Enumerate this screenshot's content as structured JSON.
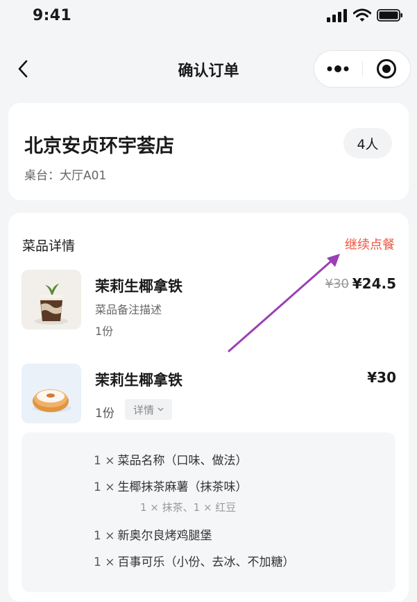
{
  "status_bar": {
    "time": "9:41"
  },
  "nav": {
    "title": "确认订单"
  },
  "store": {
    "name": "北京安贞环宇荟店",
    "table": "桌台：大厅A01",
    "people": "4人"
  },
  "order": {
    "section_title": "菜品详情",
    "continue_label": "继续点餐",
    "items": [
      {
        "name": "茉莉生椰拿铁",
        "note": "菜品备注描述",
        "qty": "1份",
        "original_price": "¥30",
        "price": "¥24.5"
      },
      {
        "name": "茉莉生椰拿铁",
        "qty": "1份",
        "price": "¥30",
        "detail_label": "详情"
      }
    ],
    "combo": [
      {
        "qty": "1 ×",
        "name": "菜品名称（口味、做法）"
      },
      {
        "qty": "1 ×",
        "name": "生椰抹茶麻薯（抹茶味）",
        "sub": "1 × 抹茶、1 × 红豆"
      },
      {
        "qty": "1 ×",
        "name": "新奥尔良烤鸡腿堡"
      },
      {
        "qty": "1 ×",
        "name": "百事可乐（小份、去冰、不加糖）"
      }
    ]
  },
  "colors": {
    "accent": "#f0553f",
    "annotation_arrow": "#9b3fb5"
  }
}
